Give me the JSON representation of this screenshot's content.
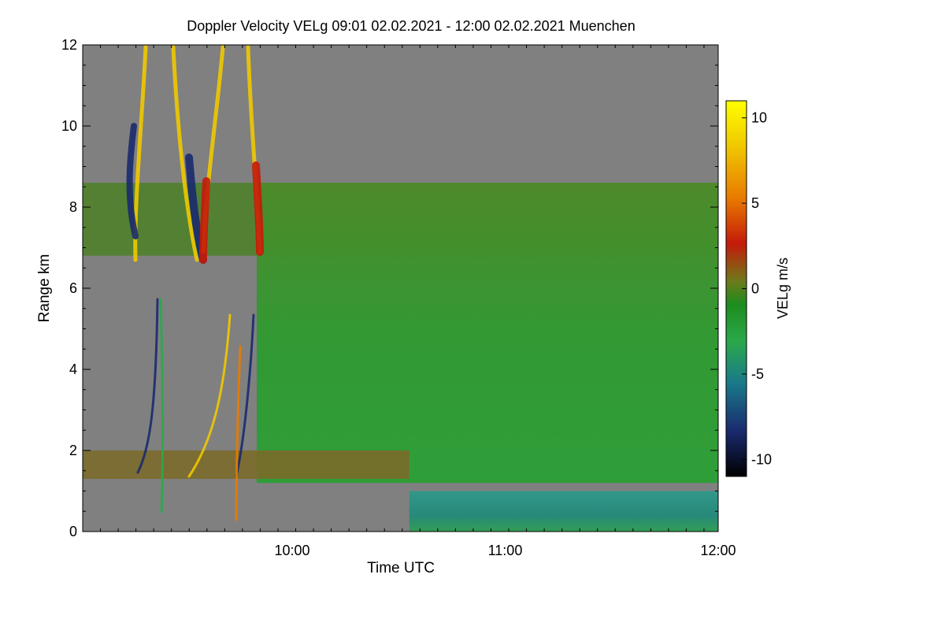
{
  "chart_data": {
    "type": "heatmap",
    "title": "Doppler Velocity VELg   09:01 02.02.2021 - 12:00 02.02.2021 Muenchen",
    "xlabel": "Time UTC",
    "ylabel": "Range km",
    "xlim": [
      "09:01",
      "12:00"
    ],
    "ylim": [
      0,
      12
    ],
    "x_tick_labels": [
      "10:00",
      "11:00",
      "12:00"
    ],
    "y_tick_labels": [
      "0",
      "2",
      "4",
      "6",
      "8",
      "10",
      "12"
    ],
    "colorbar": {
      "label": "VELg m/s",
      "range": [
        -11,
        11
      ],
      "tick_labels": [
        "-10",
        "-5",
        "0",
        "5",
        "10"
      ],
      "colormap": [
        "#000000",
        "#1a2a6e",
        "#1a7a8a",
        "#2aa84a",
        "#1e8c1e",
        "#6e7a1a",
        "#c41a0a",
        "#e87a00",
        "#f0c800",
        "#ffff00"
      ]
    },
    "background_color": "#808080",
    "regions": [
      {
        "name": "cloud upper layer",
        "x_start": "09:01",
        "x_end": "12:00",
        "y_range_km": [
          6.8,
          8.6
        ],
        "velocity_ms": -1
      },
      {
        "name": "main cloud",
        "x_start": "09:50",
        "x_end": "12:00",
        "y_range_km": [
          1.2,
          8.6
        ],
        "velocity_ms": -2
      },
      {
        "name": "boundary layer",
        "x_start": "10:33",
        "x_end": "12:00",
        "y_range_km": [
          0,
          1.0
        ],
        "velocity_ms": -4
      },
      {
        "name": "low layer",
        "x_start": "09:01",
        "x_end": "10:33",
        "y_range_km": [
          1.3,
          2.0
        ],
        "velocity_ms": 0
      }
    ]
  }
}
